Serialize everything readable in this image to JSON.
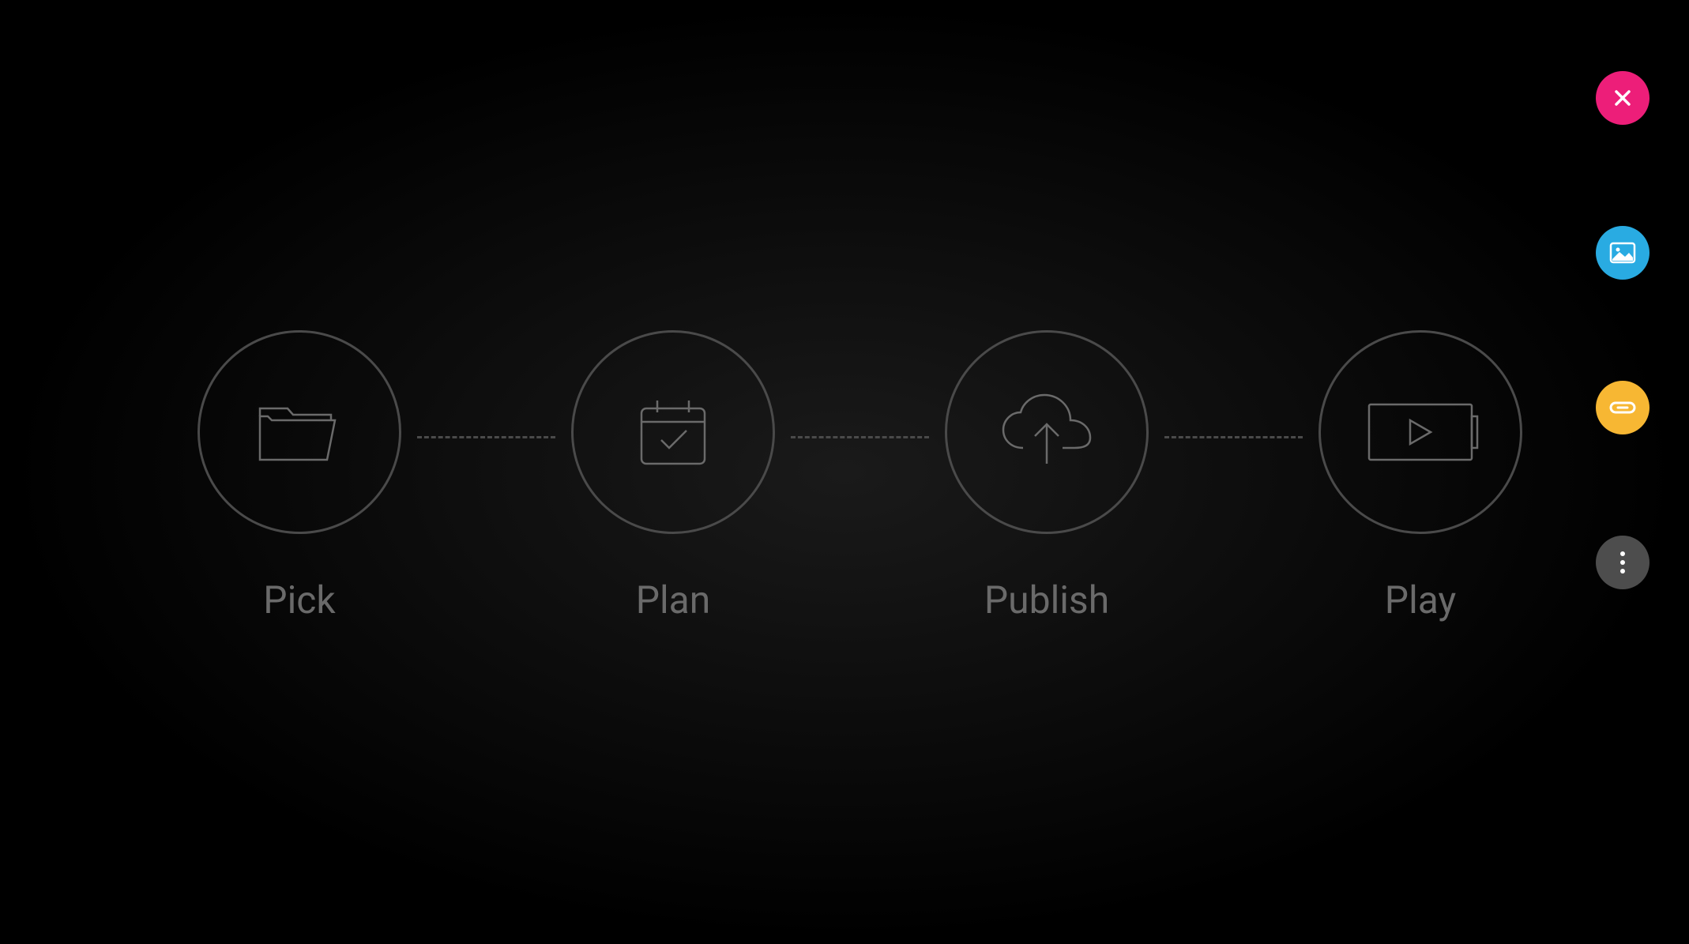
{
  "workflow": {
    "steps": [
      {
        "label": "Pick",
        "icon": "folder-icon"
      },
      {
        "label": "Plan",
        "icon": "calendar-check-icon"
      },
      {
        "label": "Publish",
        "icon": "cloud-upload-icon"
      },
      {
        "label": "Play",
        "icon": "play-screen-icon"
      }
    ]
  },
  "sidebar": {
    "buttons": [
      {
        "name": "close",
        "color": "#ed1e79"
      },
      {
        "name": "image",
        "color": "#29abe2"
      },
      {
        "name": "link",
        "color": "#f7b733"
      },
      {
        "name": "more",
        "color": "#4d4d4d"
      }
    ]
  }
}
